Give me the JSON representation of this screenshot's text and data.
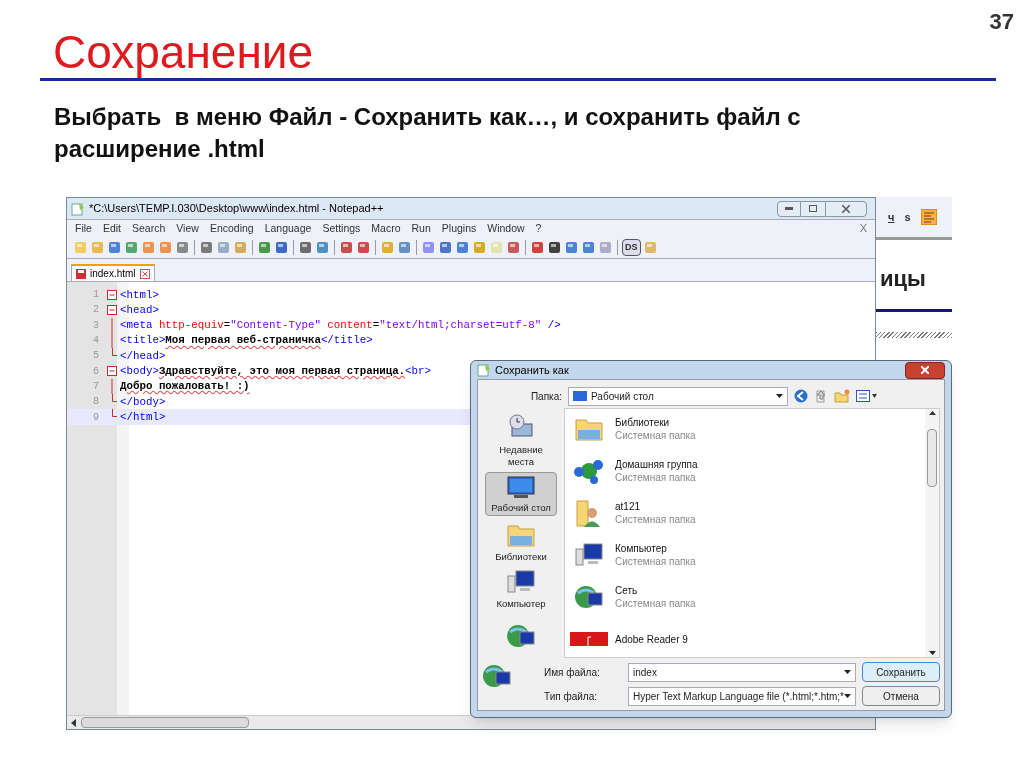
{
  "slide": {
    "page_number": "37",
    "title": "Сохранение",
    "text": "Выбрать  в меню Файл - Сохранить как…, и сохранить файл с расширение .html"
  },
  "editor": {
    "title": "*C:\\Users\\TEMP.I.030\\Desktop\\www\\index.html - Notepad++",
    "menu": [
      "File",
      "Edit",
      "Search",
      "View",
      "Encoding",
      "Language",
      "Settings",
      "Macro",
      "Run",
      "Plugins",
      "Window",
      "?"
    ],
    "menu_close": "X",
    "toolbar_label": "DS",
    "tab": {
      "label": "index.html",
      "selected": true
    },
    "lines": [
      {
        "number": "1",
        "kind": "open",
        "current": false,
        "tokens": [
          {
            "kind": "tag",
            "text": "<html>"
          }
        ]
      },
      {
        "number": "2",
        "kind": "open",
        "current": false,
        "tokens": [
          {
            "kind": "tag",
            "text": "<head>"
          }
        ]
      },
      {
        "number": "3",
        "kind": "inner",
        "current": false,
        "tokens": [
          {
            "kind": "tag",
            "text": "<meta "
          },
          {
            "kind": "attr",
            "text": "http-equiv"
          },
          {
            "kind": "plain",
            "text": "="
          },
          {
            "kind": "string",
            "text": "\"Content-Type\""
          },
          {
            "kind": "attr",
            "text": " content"
          },
          {
            "kind": "plain",
            "text": "="
          },
          {
            "kind": "string",
            "text": "\"text/html;charset=utf-8\""
          },
          {
            "kind": "tag",
            "text": " />"
          }
        ]
      },
      {
        "number": "4",
        "kind": "inner",
        "current": false,
        "tokens": [
          {
            "kind": "tag",
            "text": "<title>"
          },
          {
            "kind": "text",
            "text": "Моя первая веб-страничка"
          },
          {
            "kind": "tag",
            "text": "</title>"
          }
        ]
      },
      {
        "number": "5",
        "kind": "close",
        "current": false,
        "tokens": [
          {
            "kind": "tag",
            "text": "</head>"
          }
        ]
      },
      {
        "number": "6",
        "kind": "open",
        "current": false,
        "tokens": [
          {
            "kind": "tag",
            "text": "<body>"
          },
          {
            "kind": "text",
            "text": "Здравствуйте, это моя первая страница."
          },
          {
            "kind": "tag",
            "text": "<br>"
          }
        ]
      },
      {
        "number": "7",
        "kind": "inner",
        "current": false,
        "tokens": [
          {
            "kind": "text",
            "text": "Добро пожаловать! :)"
          }
        ]
      },
      {
        "number": "8",
        "kind": "close",
        "current": false,
        "tokens": [
          {
            "kind": "tag",
            "text": "</body>"
          }
        ]
      },
      {
        "number": "9",
        "kind": "close",
        "current": true,
        "tokens": [
          {
            "kind": "tag",
            "text": "</html>"
          }
        ]
      }
    ]
  },
  "background_window": {
    "toolbar": [
      "ч",
      "s"
    ],
    "heading": "ицы"
  },
  "dialog": {
    "title": "Сохранить как",
    "folder_label": "Папка:",
    "folder": "Рабочий стол",
    "places": [
      {
        "kind": "recent",
        "label": "Недавние места",
        "selected": false
      },
      {
        "kind": "desktop",
        "label": "Рабочий стол",
        "selected": true
      },
      {
        "kind": "library",
        "label": "Библиотеки",
        "selected": false
      },
      {
        "kind": "computer",
        "label": "Компьютер",
        "selected": false
      },
      {
        "kind": "network",
        "selected": false
      }
    ],
    "items": [
      {
        "kind": "library",
        "name": "Библиотеки",
        "type": "Системная папка"
      },
      {
        "kind": "homegroup",
        "name": "Домашняя группа",
        "type": "Системная папка"
      },
      {
        "kind": "user",
        "name": "at121",
        "type": "Системная папка"
      },
      {
        "kind": "computer",
        "name": "Компьютер",
        "type": "Системная папка"
      },
      {
        "kind": "network",
        "name": "Сеть",
        "type": "Системная папка"
      },
      {
        "kind": "pdf",
        "name": "Adobe Reader 9"
      }
    ],
    "filename_label": "Имя файла:",
    "filename": "index",
    "filetype_label": "Тип файла:",
    "filetype": "Hyper Text Markup Language file (*.html;*.htm;*",
    "buttons": [
      {
        "label": "Сохранить",
        "default": true
      },
      {
        "label": "Отмена",
        "default": false
      }
    ]
  }
}
